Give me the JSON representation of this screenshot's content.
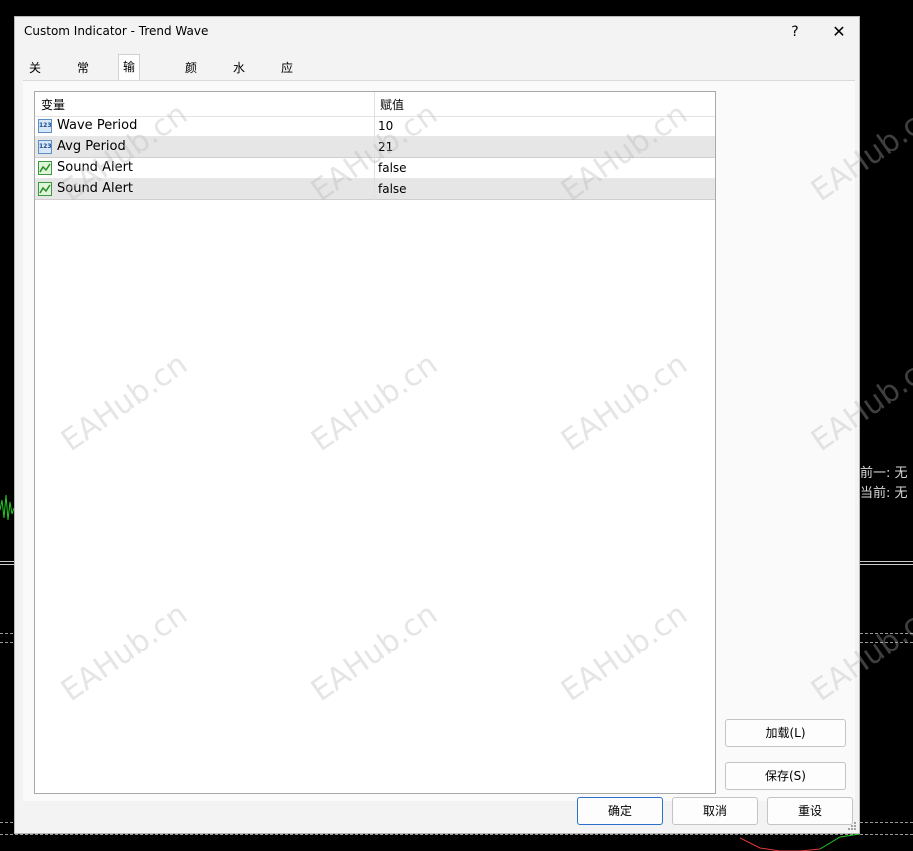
{
  "window": {
    "title": "Custom Indicator - Trend Wave",
    "help_label": "?",
    "close_label": "✕"
  },
  "tabs": [
    {
      "label": "关于"
    },
    {
      "label": "常用"
    },
    {
      "label": "输入参数"
    },
    {
      "label": "颜色"
    },
    {
      "label": "水平位"
    },
    {
      "label": "应用范围"
    }
  ],
  "table": {
    "headers": {
      "name": "变量",
      "value": "赋值"
    },
    "rows": [
      {
        "name": "Wave Period",
        "value": "10",
        "icon": "integer-param-icon",
        "icon_text": "123"
      },
      {
        "name": "Avg Period",
        "value": "21",
        "icon": "integer-param-icon",
        "icon_text": "123"
      },
      {
        "name": "Sound Alert",
        "value": "false",
        "icon": "boolean-param-icon"
      },
      {
        "name": "Sound Alert",
        "value": "false",
        "icon": "boolean-param-icon"
      }
    ]
  },
  "side_buttons": {
    "load": "加载(L)",
    "save": "保存(S)"
  },
  "footer": {
    "ok": "确定",
    "cancel": "取消",
    "reset": "重设"
  },
  "background": {
    "text1": "前一: 无",
    "text2": "当前: 无"
  },
  "watermark": "EAHub.cn",
  "colors": {
    "primary_border": "#2a71c9",
    "alt_row": "#e6e6e6"
  }
}
